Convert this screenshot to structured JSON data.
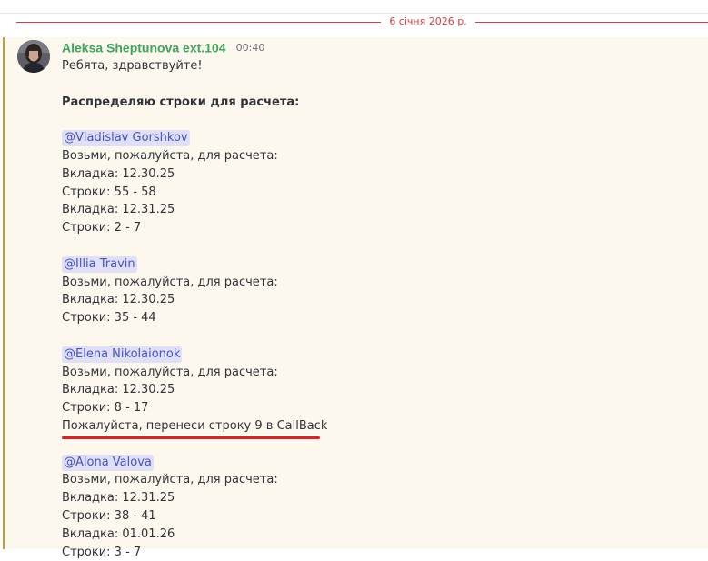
{
  "date_divider": "6 січня 2026 р.",
  "message": {
    "author": "Aleksa Sheptunova ext.104",
    "time": "00:40",
    "greeting": "Ребята, здравствуйте!",
    "heading": "Распределяю строки для расчета:",
    "assignments": [
      {
        "mention": "@Vladislav Gorshkov",
        "lines": [
          "Возьми, пожалуйста, для расчета:",
          "Вкладка: 12.30.25",
          "Строки: 55 - 58",
          "Вкладка: 12.31.25",
          "Строки: 2 - 7"
        ]
      },
      {
        "mention": "@Illia Travin",
        "lines": [
          "Возьми, пожалуйста, для расчета:",
          "Вкладка: 12.30.25",
          "Строки: 35 - 44"
        ]
      },
      {
        "mention": "@Elena Nikolaionok",
        "lines": [
          "Возьми, пожалуйста, для расчета:",
          "Вкладка: 12.30.25",
          "Строки: 8 - 17",
          "Пожалуйста, перенеси строку 9 в CallBack"
        ]
      },
      {
        "mention": "@Alona Valova",
        "lines": [
          "Возьми, пожалуйста, для расчета:",
          "Вкладка: 12.31.25",
          "Строки: 38 - 41",
          "Вкладка: 01.01.26",
          "Строки: 3 - 7"
        ]
      }
    ]
  },
  "colors": {
    "author": "#3ba55c",
    "divider": "#d83c3e",
    "mention_bg": "#dfe0f7",
    "mention_text": "#4752c4",
    "highlight_bg": "#fdf8ee",
    "highlight_bar": "#c89a2f",
    "annotation_underline": "#e31e24"
  },
  "icons": {
    "avatar": "user-avatar-photo"
  }
}
